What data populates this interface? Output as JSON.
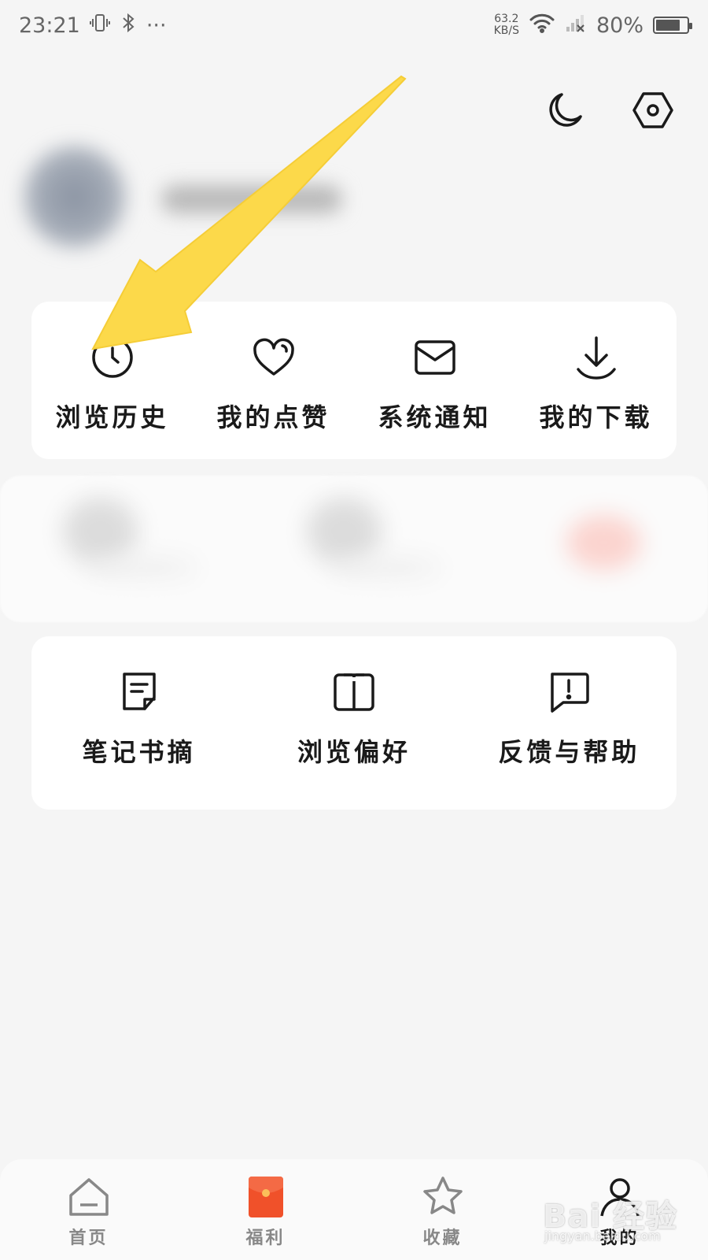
{
  "status_bar": {
    "time": "23:21",
    "more": "···",
    "speed_value": "63.2",
    "speed_unit": "KB/S",
    "battery": "80%",
    "battery_level": 0.8
  },
  "quick_actions": [
    {
      "label": "浏览历史",
      "icon": "clock-icon"
    },
    {
      "label": "我的点赞",
      "icon": "heart-icon"
    },
    {
      "label": "系统通知",
      "icon": "mail-icon"
    },
    {
      "label": "我的下载",
      "icon": "download-icon"
    }
  ],
  "tools": [
    {
      "label": "笔记书摘",
      "icon": "note-icon"
    },
    {
      "label": "浏览偏好",
      "icon": "book-icon"
    },
    {
      "label": "反馈与帮助",
      "icon": "feedback-icon"
    }
  ],
  "bottom_nav": [
    {
      "label": "首页",
      "icon": "home-icon"
    },
    {
      "label": "福利",
      "icon": "red-envelope-icon"
    },
    {
      "label": "收藏",
      "icon": "star-icon"
    },
    {
      "label": "我的",
      "icon": "user-icon",
      "active": true
    }
  ],
  "watermark": {
    "text": "Bai 经验",
    "sub": "jingyan.baidu.com"
  },
  "colors": {
    "arrow": "#fcd94a",
    "red_envelope": "#f0512a",
    "background": "#f5f5f5"
  }
}
